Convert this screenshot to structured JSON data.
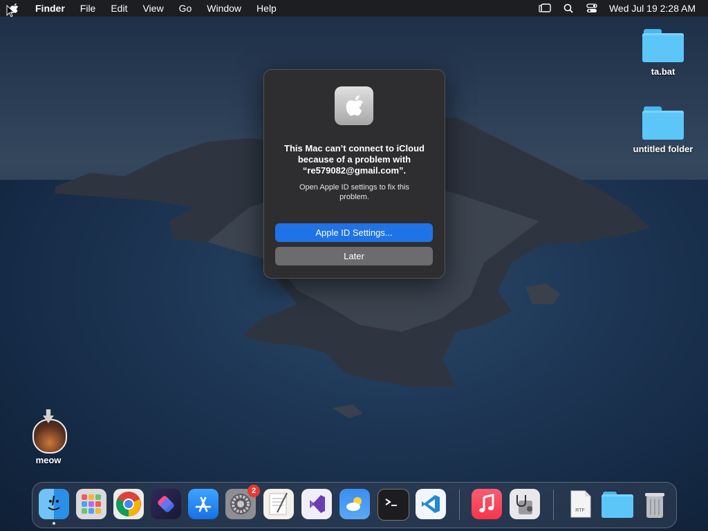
{
  "menubar": {
    "app_name": "Finder",
    "items": [
      "File",
      "Edit",
      "View",
      "Go",
      "Window",
      "Help"
    ],
    "clock": "Wed Jul 19  2:28 AM",
    "icons": [
      "stage-manager-icon",
      "search-icon",
      "control-center-icon"
    ]
  },
  "desktop": {
    "folders": [
      {
        "label": "ta.bat"
      },
      {
        "label": "untitled folder"
      }
    ],
    "installer": {
      "label": "meow"
    }
  },
  "dialog": {
    "title": "This Mac can’t connect to iCloud because of a problem with “re579082@gmail.com”.",
    "message": "Open Apple ID settings to fix this problem.",
    "primary_button": "Apple ID Settings...",
    "secondary_button": "Later"
  },
  "dock": {
    "apps": [
      "Finder",
      "Launchpad",
      "Google Chrome",
      "Shortcuts",
      "App Store",
      "System Settings",
      "TextEdit",
      "Visual Studio",
      "Weather",
      "Terminal",
      "Visual Studio Code",
      "Music",
      "Disk Utility",
      "Document",
      "Folder",
      "Trash"
    ],
    "settings_badge": "2",
    "document_label": "RTF"
  },
  "colors": {
    "accent": "#1f73e6",
    "badge": "#e53a32"
  }
}
